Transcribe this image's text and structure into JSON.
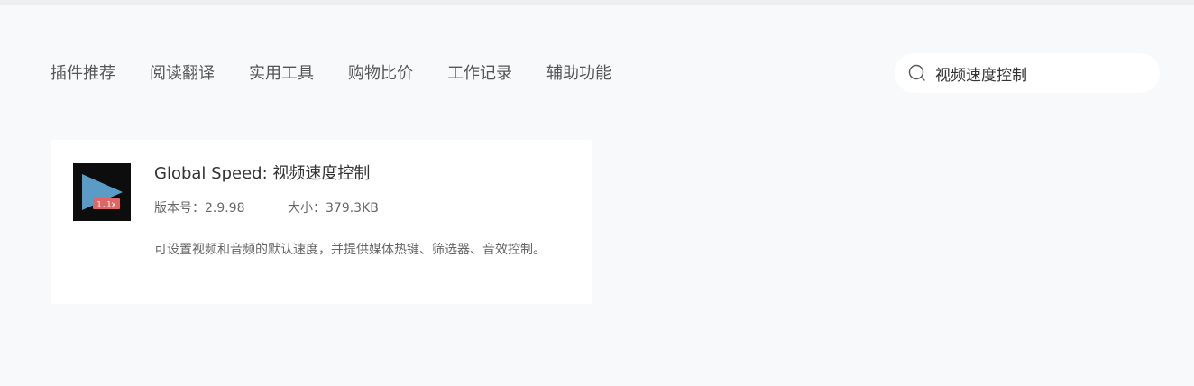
{
  "nav": {
    "items": [
      {
        "label": "插件推荐"
      },
      {
        "label": "阅读翻译"
      },
      {
        "label": "实用工具"
      },
      {
        "label": "购物比价"
      },
      {
        "label": "工作记录"
      },
      {
        "label": "辅助功能"
      }
    ]
  },
  "search": {
    "value": "视频速度控制",
    "icon": "search-icon"
  },
  "result": {
    "icon": "play-speed-icon",
    "icon_badge": "1.1x",
    "title": "Global Speed: 视频速度控制",
    "version_label": "版本号：2.9.98",
    "size_label": "大小：379.3KB",
    "description": "可设置视频和音频的默认速度，并提供媒体热键、筛选器、音效控制。"
  },
  "colors": {
    "background": "#f8f9fa",
    "card": "#ffffff",
    "icon_triangle": "#5b9cc7",
    "icon_badge": "#e06666"
  }
}
